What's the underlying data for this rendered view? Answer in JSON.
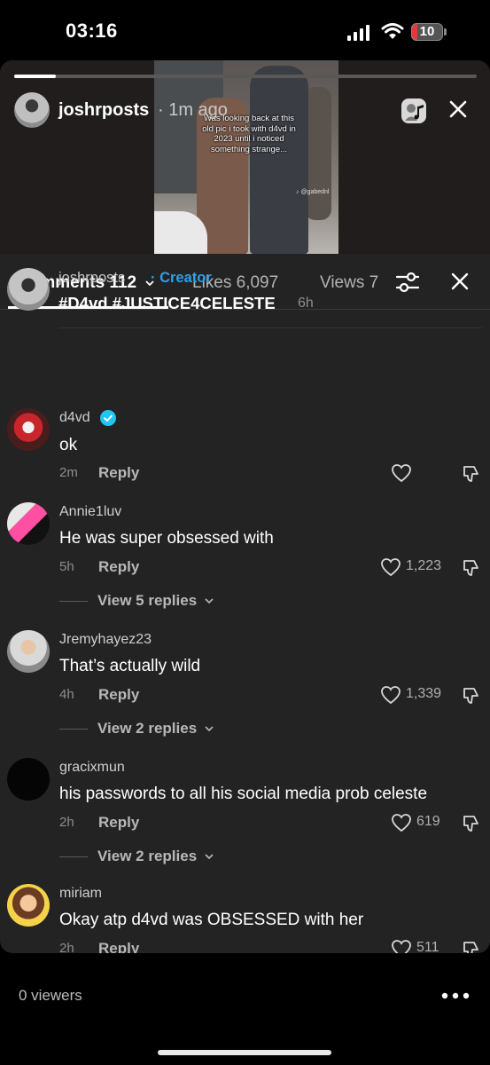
{
  "status_bar": {
    "time": "03:16",
    "battery": "10"
  },
  "story": {
    "username": "joshrposts",
    "time_ago": "· 1m ago",
    "progress": 0.09,
    "caption": "Was looking back at this\nold pic i took with d4vd in\n2023 until i noticed\nsomething strange...",
    "watermark": "♪ @gabednl"
  },
  "tabs": {
    "comments": "Comments 112",
    "likes": "Likes 6,097",
    "views": "Views 7"
  },
  "creator_caption": {
    "username": "joshrposts",
    "badge": "· Creator",
    "text": "#D4vd #JUSTICE4CELESTE",
    "time": "6h"
  },
  "reply_label": "Reply",
  "comments": [
    {
      "username": "d4vd",
      "text": "ok",
      "time": "2m",
      "likes": "",
      "view_replies": ""
    },
    {
      "username": "Annie1luv",
      "text": "He was super obsessed with",
      "time": "5h",
      "likes": "1,223",
      "view_replies": "View 5 replies"
    },
    {
      "username": "Jremyhayez23",
      "text": "That’s actually wild",
      "time": "4h",
      "likes": "1,339",
      "view_replies": "View 2 replies"
    },
    {
      "username": "gracixmun",
      "text": "his passwords to all his social media prob celeste",
      "time": "2h",
      "likes": "619",
      "view_replies": "View 2 replies"
    },
    {
      "username": "miriam",
      "text": "Okay atp d4vd was OBSESSED with her",
      "time": "2h",
      "likes": "511",
      "view_replies": ""
    }
  ],
  "footer": {
    "viewers": "0 viewers"
  },
  "colors": {
    "creator_badge": "#2f9fe8",
    "card_bg": "#232323",
    "verified": "#20c5f0"
  }
}
